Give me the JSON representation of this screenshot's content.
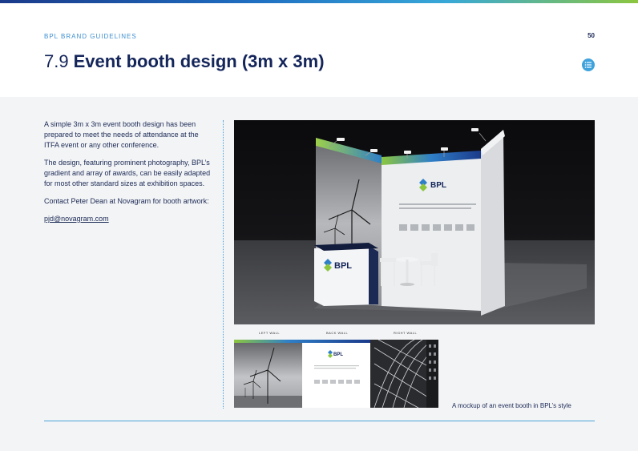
{
  "header": {
    "kicker": "BPL BRAND GUIDELINES",
    "page_number": "50",
    "section_number": "7.9",
    "section_title": "Event booth design (3m x 3m)",
    "menu_icon": "list-icon"
  },
  "body": {
    "paragraphs": [
      "A simple 3m x 3m event booth design has been prepared to meet the needs of attendance at the ITFA event or any other conference.",
      "The design, featuring prominent photography, BPL’s gradient and array of awards, can be easily adapted for most other standard sizes at exhibition spaces.",
      "Contact Peter Dean at Novagram for booth artwork:"
    ],
    "email": "pjd@novagram.com"
  },
  "figure": {
    "brand_logo_text": "BPL",
    "wall_labels": [
      "LEFT WALL",
      "BACK WALL",
      "RIGHT WALL"
    ],
    "caption": "A mockup of an event booth in BPL’s style"
  },
  "colors": {
    "navy": "#14255a",
    "accent_blue": "#3ea3dc",
    "gradient_green": "#8cc63f"
  }
}
